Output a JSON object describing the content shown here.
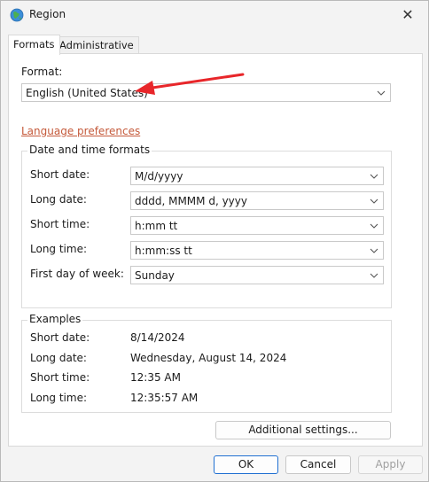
{
  "window": {
    "title": "Region",
    "close_glyph": "✕"
  },
  "tabs": [
    {
      "label": "Formats",
      "active": true
    },
    {
      "label": "Administrative",
      "active": false
    }
  ],
  "format": {
    "label": "Format:",
    "value": "English (United States)"
  },
  "language_link": "Language preferences",
  "datetime": {
    "title": "Date and time formats",
    "rows": [
      {
        "label": "Short date:",
        "value": "M/d/yyyy"
      },
      {
        "label": "Long date:",
        "value": "dddd, MMMM d, yyyy"
      },
      {
        "label": "Short time:",
        "value": "h:mm tt"
      },
      {
        "label": "Long time:",
        "value": "h:mm:ss tt"
      },
      {
        "label": "First day of week:",
        "value": "Sunday"
      }
    ]
  },
  "examples": {
    "title": "Examples",
    "rows": [
      {
        "label": "Short date:",
        "value": "8/14/2024"
      },
      {
        "label": "Long date:",
        "value": "Wednesday, August 14, 2024"
      },
      {
        "label": "Short time:",
        "value": "12:35 AM"
      },
      {
        "label": "Long time:",
        "value": "12:35:57 AM"
      }
    ]
  },
  "buttons": {
    "additional": "Additional settings...",
    "ok": "OK",
    "cancel": "Cancel",
    "apply": "Apply"
  },
  "colors": {
    "arrow": "#e8262a",
    "link": "#c55a3b",
    "focus": "#1f6fd1"
  }
}
